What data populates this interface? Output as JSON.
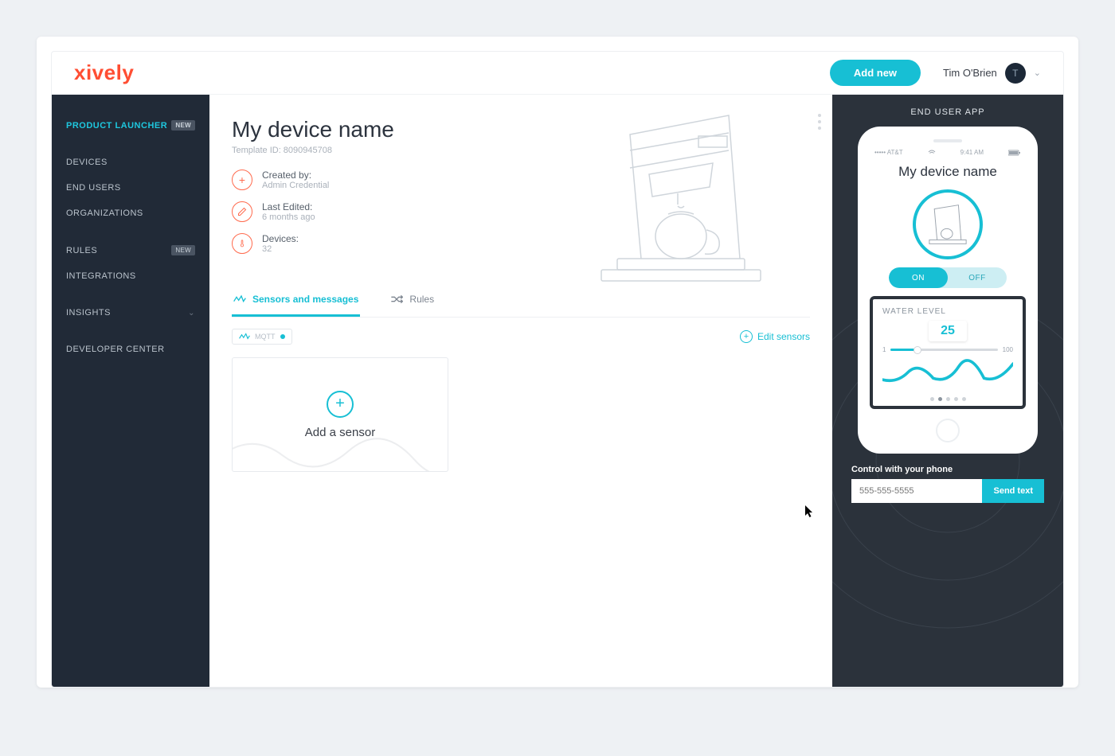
{
  "brand": "xively",
  "header": {
    "add_new": "Add new",
    "user_name": "Tim O'Brien",
    "user_initial": "T"
  },
  "sidebar": {
    "product_launcher": "PRODUCT LAUNCHER",
    "badge_new": "NEW",
    "devices": "DEVICES",
    "end_users": "END USERS",
    "organizations": "ORGANIZATIONS",
    "rules": "RULES",
    "integrations": "INTEGRATIONS",
    "insights": "INSIGHTS",
    "developer_center": "DEVELOPER CENTER"
  },
  "content": {
    "title": "My device name",
    "template_line": "Template ID: 8090945708",
    "created": {
      "label": "Created by:",
      "value": "Admin Credential"
    },
    "edited": {
      "label": "Last Edited:",
      "value": "6 months ago"
    },
    "devices": {
      "label": "Devices:",
      "value": "32"
    },
    "tabs": {
      "sensors": "Sensors and messages",
      "rules": "Rules"
    },
    "chip": "MQTT",
    "edit_sensors": "Edit sensors",
    "add_sensor": "Add a sensor"
  },
  "right": {
    "title": "END USER APP",
    "status_left": "••••• AT&T",
    "status_time": "9:41 AM",
    "screen_title": "My device name",
    "on": "ON",
    "off": "OFF",
    "widget_label": "WATER LEVEL",
    "widget_value": "25",
    "slider_min": "1",
    "slider_max": "100",
    "cta_label": "Control with your phone",
    "phone_placeholder": "555-555-5555",
    "send": "Send text"
  }
}
